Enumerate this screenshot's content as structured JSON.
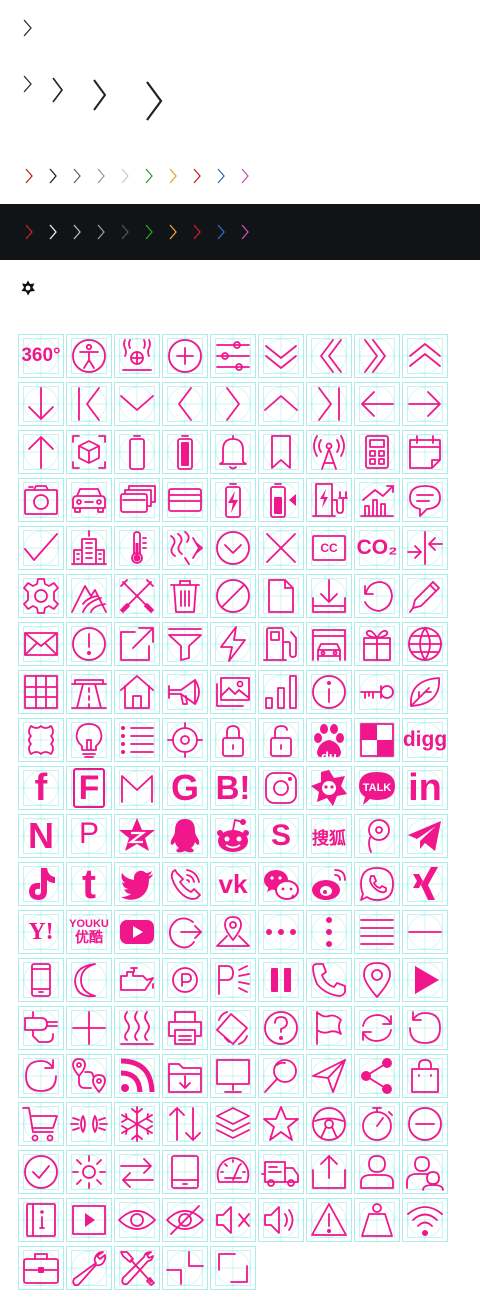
{
  "colors": {
    "accent": "#f0168c",
    "guide": "#5ee3df",
    "dark_band": "#111417",
    "chevron_dark": "#222222",
    "chevron_light": "#dddddd",
    "palette": [
      "#cc2222",
      "#222222",
      "#666666",
      "#999999",
      "#cccccc",
      "#2e9e2e",
      "#e8a13a",
      "#cc2222",
      "#2a6fbf",
      "#cc4fbf"
    ],
    "palette_dark": [
      "#cc2222",
      "#eeeeee",
      "#bbbbbb",
      "#999999",
      "#555555",
      "#2e9e2e",
      "#e8a13a",
      "#cc2222",
      "#2a6fbf",
      "#cc4fbf"
    ]
  },
  "small_star_icon": "settings-flower-icon",
  "icons": [
    {
      "name": "360-degrees",
      "text": "360°"
    },
    {
      "name": "accessibility-icon"
    },
    {
      "name": "air-heating-icon"
    },
    {
      "name": "add-circle-icon"
    },
    {
      "name": "sliders-icon"
    },
    {
      "name": "double-chevron-down-icon"
    },
    {
      "name": "double-chevron-left-icon"
    },
    {
      "name": "double-chevron-right-icon"
    },
    {
      "name": "double-chevron-up-icon"
    },
    {
      "name": "arrow-down-icon"
    },
    {
      "name": "first-page-icon"
    },
    {
      "name": "chevron-down-icon"
    },
    {
      "name": "chevron-left-icon"
    },
    {
      "name": "chevron-right-icon"
    },
    {
      "name": "chevron-up-icon"
    },
    {
      "name": "last-page-icon"
    },
    {
      "name": "arrow-left-icon"
    },
    {
      "name": "arrow-right-icon"
    },
    {
      "name": "arrow-up-icon"
    },
    {
      "name": "ar-cube-icon"
    },
    {
      "name": "battery-empty-icon"
    },
    {
      "name": "battery-full-icon"
    },
    {
      "name": "bell-icon"
    },
    {
      "name": "bookmark-icon"
    },
    {
      "name": "broadcast-tower-icon"
    },
    {
      "name": "calculator-icon"
    },
    {
      "name": "calendar-icon"
    },
    {
      "name": "camera-icon"
    },
    {
      "name": "car-front-icon"
    },
    {
      "name": "cards-icon"
    },
    {
      "name": "credit-card-icon"
    },
    {
      "name": "battery-charging-icon"
    },
    {
      "name": "battery-level-icon"
    },
    {
      "name": "ev-charging-icon"
    },
    {
      "name": "chart-trend-icon"
    },
    {
      "name": "chat-bubble-icon"
    },
    {
      "name": "checkmark-icon"
    },
    {
      "name": "city-building-icon"
    },
    {
      "name": "thermometer-icon"
    },
    {
      "name": "climate-airflow-icon"
    },
    {
      "name": "chevron-down-circle-icon"
    },
    {
      "name": "close-icon"
    },
    {
      "name": "closed-captions-icon",
      "text": "CC"
    },
    {
      "name": "co2-icon",
      "text": "CO₂"
    },
    {
      "name": "collapse-arrows-icon"
    },
    {
      "name": "gear-icon"
    },
    {
      "name": "terrain-road-icon"
    },
    {
      "name": "crossed-tools-icon"
    },
    {
      "name": "trash-icon"
    },
    {
      "name": "prohibited-icon"
    },
    {
      "name": "document-icon"
    },
    {
      "name": "download-tray-icon"
    },
    {
      "name": "refresh-dashed-icon"
    },
    {
      "name": "pencil-icon"
    },
    {
      "name": "envelope-icon"
    },
    {
      "name": "exclamation-circle-icon"
    },
    {
      "name": "external-link-icon"
    },
    {
      "name": "filter-funnel-icon"
    },
    {
      "name": "lightning-icon"
    },
    {
      "name": "fuel-pump-icon"
    },
    {
      "name": "garage-car-icon"
    },
    {
      "name": "gift-icon"
    },
    {
      "name": "globe-icon"
    },
    {
      "name": "grid-table-icon"
    },
    {
      "name": "highway-icon"
    },
    {
      "name": "home-icon"
    },
    {
      "name": "horn-icon"
    },
    {
      "name": "image-gallery-icon"
    },
    {
      "name": "bar-chart-icon"
    },
    {
      "name": "info-circle-icon"
    },
    {
      "name": "key-icon"
    },
    {
      "name": "leaf-icon"
    },
    {
      "name": "leather-hide-icon"
    },
    {
      "name": "light-bulb-icon"
    },
    {
      "name": "list-icon"
    },
    {
      "name": "target-locate-icon"
    },
    {
      "name": "lock-closed-icon"
    },
    {
      "name": "lock-open-icon"
    },
    {
      "name": "baidu-icon",
      "text": "du"
    },
    {
      "name": "delicious-icon"
    },
    {
      "name": "digg-icon",
      "text": "digg"
    },
    {
      "name": "facebook-icon",
      "text": "f"
    },
    {
      "name": "foursquare-icon",
      "text": "F"
    },
    {
      "name": "gmail-icon"
    },
    {
      "name": "google-icon",
      "text": "G"
    },
    {
      "name": "hatena-icon",
      "text": "B!"
    },
    {
      "name": "instagram-icon"
    },
    {
      "name": "kaixin-icon"
    },
    {
      "name": "kakaotalk-icon",
      "text": "TALK"
    },
    {
      "name": "linkedin-icon",
      "text": "in"
    },
    {
      "name": "naver-icon",
      "text": "N"
    },
    {
      "name": "pinterest-icon",
      "text": "P"
    },
    {
      "name": "qzone-icon"
    },
    {
      "name": "qq-icon"
    },
    {
      "name": "reddit-icon"
    },
    {
      "name": "skyrock-icon",
      "text": "S"
    },
    {
      "name": "sohu-icon",
      "text": "搜狐"
    },
    {
      "name": "tencent-weibo-icon"
    },
    {
      "name": "telegram-icon"
    },
    {
      "name": "tiktok-icon"
    },
    {
      "name": "tumblr-icon",
      "text": "t"
    },
    {
      "name": "twitter-icon"
    },
    {
      "name": "viber-icon"
    },
    {
      "name": "vk-icon",
      "text": "vk"
    },
    {
      "name": "wechat-icon"
    },
    {
      "name": "weibo-icon"
    },
    {
      "name": "whatsapp-icon"
    },
    {
      "name": "xing-icon"
    },
    {
      "name": "yahoo-icon",
      "text": "Y!"
    },
    {
      "name": "youku-icon",
      "text": "YOUKU",
      "text2": "优酷"
    },
    {
      "name": "youtube-icon"
    },
    {
      "name": "logout-icon"
    },
    {
      "name": "map-pin-icon"
    },
    {
      "name": "more-horizontal-icon"
    },
    {
      "name": "more-vertical-icon"
    },
    {
      "name": "menu-lines-icon"
    },
    {
      "name": "minus-line-icon"
    },
    {
      "name": "mobile-phone-icon"
    },
    {
      "name": "moon-icon"
    },
    {
      "name": "oil-can-icon"
    },
    {
      "name": "parking-circle-icon",
      "text": "P"
    },
    {
      "name": "parking-sensor-icon",
      "text": "P"
    },
    {
      "name": "pause-icon"
    },
    {
      "name": "phone-icon"
    },
    {
      "name": "location-pin-icon"
    },
    {
      "name": "play-icon"
    },
    {
      "name": "plug-icon"
    },
    {
      "name": "plus-icon"
    },
    {
      "name": "heat-waves-icon"
    },
    {
      "name": "printer-icon"
    },
    {
      "name": "rotate-screen-icon"
    },
    {
      "name": "question-circle-icon"
    },
    {
      "name": "flag-icon"
    },
    {
      "name": "sync-icon"
    },
    {
      "name": "rotate-left-icon"
    },
    {
      "name": "rotate-right-icon"
    },
    {
      "name": "route-icon"
    },
    {
      "name": "rss-feed-icon"
    },
    {
      "name": "folder-download-icon"
    },
    {
      "name": "monitor-icon"
    },
    {
      "name": "search-icon"
    },
    {
      "name": "send-icon"
    },
    {
      "name": "share-icon"
    },
    {
      "name": "shopping-bag-icon"
    },
    {
      "name": "shopping-cart-icon"
    },
    {
      "name": "side-lights-icon"
    },
    {
      "name": "snowflake-icon"
    },
    {
      "name": "sort-arrows-icon"
    },
    {
      "name": "layers-icon"
    },
    {
      "name": "star-icon"
    },
    {
      "name": "steering-wheel-icon"
    },
    {
      "name": "stopwatch-icon"
    },
    {
      "name": "minus-circle-icon"
    },
    {
      "name": "check-circle-icon"
    },
    {
      "name": "sun-icon"
    },
    {
      "name": "swap-arrows-icon"
    },
    {
      "name": "tablet-icon"
    },
    {
      "name": "speedometer-icon"
    },
    {
      "name": "delivery-truck-icon"
    },
    {
      "name": "upload-icon"
    },
    {
      "name": "user-icon"
    },
    {
      "name": "user-group-icon"
    },
    {
      "name": "user-manual-icon"
    },
    {
      "name": "video-player-icon"
    },
    {
      "name": "eye-icon"
    },
    {
      "name": "eye-off-icon"
    },
    {
      "name": "volume-mute-icon"
    },
    {
      "name": "volume-up-icon"
    },
    {
      "name": "warning-triangle-icon"
    },
    {
      "name": "weight-icon"
    },
    {
      "name": "wifi-icon"
    },
    {
      "name": "briefcase-icon"
    },
    {
      "name": "wrench-icon"
    },
    {
      "name": "tools-icon"
    },
    {
      "name": "compress-corner-icon"
    },
    {
      "name": "expand-corner-icon"
    }
  ]
}
